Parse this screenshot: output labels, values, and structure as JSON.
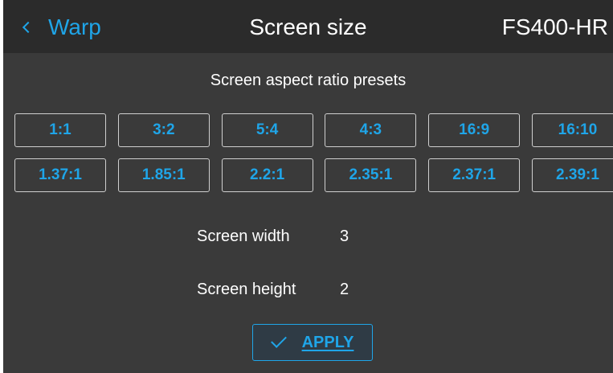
{
  "header": {
    "back_label": "Warp",
    "title": "Screen size",
    "device": "FS400-HR"
  },
  "presets": {
    "heading": "Screen aspect ratio presets",
    "items": [
      "1:1",
      "3:2",
      "5:4",
      "4:3",
      "16:9",
      "16:10",
      "1.37:1",
      "1.85:1",
      "2.2:1",
      "2.35:1",
      "2.37:1",
      "2.39:1"
    ]
  },
  "fields": {
    "width_label": "Screen width",
    "width_value": "3",
    "height_label": "Screen height",
    "height_value": "2"
  },
  "apply": {
    "label": "APPLY",
    "icon": "check-icon"
  },
  "colors": {
    "accent": "#1fa5e8",
    "background": "#3a3a3a",
    "header_background": "#2b2b2b",
    "text": "#ffffff"
  }
}
